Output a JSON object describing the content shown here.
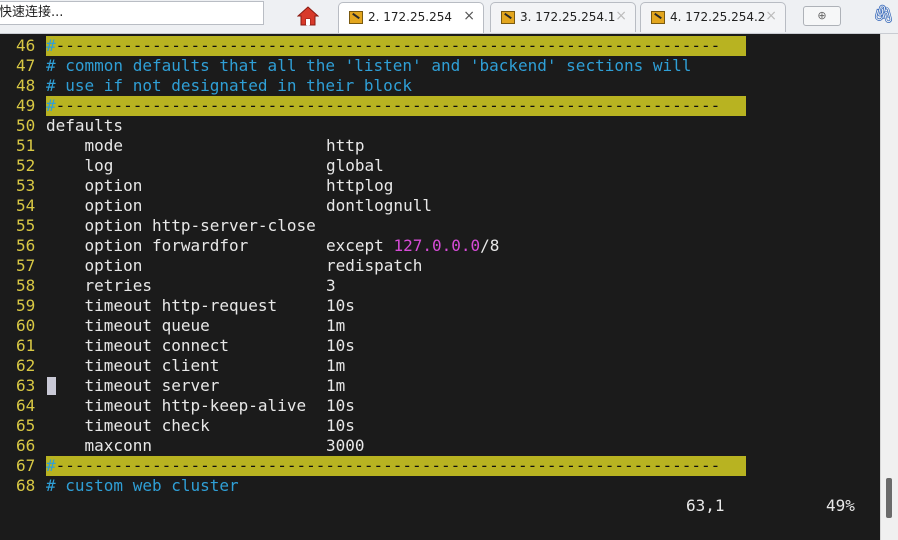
{
  "toolbar": {
    "quick_connect_placeholder": "快速连接..."
  },
  "tabs": [
    {
      "label": "2. 172.25.254",
      "active": true
    },
    {
      "label": "3. 172.25.254.1",
      "active": false
    },
    {
      "label": "4. 172.25.254.2",
      "active": false
    }
  ],
  "tab_close_glyph": "×",
  "icons": {
    "home": "home-icon",
    "session": "terminal-session-icon",
    "new_tab": "new-tab-icon",
    "attach": "paperclip-icon"
  },
  "colors": {
    "background": "#1b1b1b",
    "line_number": "#d8c844",
    "comment": "#2f9fd6",
    "highlight_bar": "#b8b321",
    "number_literal": "#d64bd6",
    "text": "#e8e8e8"
  },
  "editor": {
    "lines": [
      {
        "n": "46",
        "hash": "#",
        "rest": "---------------------------------------------------------------------"
      },
      {
        "n": "47",
        "comment": "# common defaults that all the 'listen' and 'backend' sections will"
      },
      {
        "n": "48",
        "comment": "# use if not designated in their block"
      },
      {
        "n": "49",
        "hash": "#",
        "rest": "---------------------------------------------------------------------"
      },
      {
        "n": "50",
        "key": "defaults",
        "val": ""
      },
      {
        "n": "51",
        "key": "    mode",
        "val": "http"
      },
      {
        "n": "52",
        "key": "    log",
        "val": "global"
      },
      {
        "n": "53",
        "key": "    option",
        "val": "httplog"
      },
      {
        "n": "54",
        "key": "    option",
        "val": "dontlognull"
      },
      {
        "n": "55",
        "key": "    option http-server-close",
        "val": ""
      },
      {
        "n": "56",
        "key": "    option forwardfor",
        "val": "except",
        "ip": "127.0.0.0",
        "suffix": "/8"
      },
      {
        "n": "57",
        "key": "    option",
        "val": "redispatch"
      },
      {
        "n": "58",
        "key": "    retries",
        "val": "3"
      },
      {
        "n": "59",
        "key": "    timeout http-request",
        "val": "10s"
      },
      {
        "n": "60",
        "key": "    timeout queue",
        "val": "1m"
      },
      {
        "n": "61",
        "key": "    timeout connect",
        "val": "10s"
      },
      {
        "n": "62",
        "key": "    timeout client",
        "val": "1m"
      },
      {
        "n": "63",
        "key": "    timeout server",
        "val": "1m"
      },
      {
        "n": "64",
        "key": "    timeout http-keep-alive",
        "val": "10s"
      },
      {
        "n": "65",
        "key": "    timeout check",
        "val": "10s"
      },
      {
        "n": "66",
        "key": "    maxconn",
        "val": "3000"
      },
      {
        "n": "67",
        "hash": "#",
        "rest": "---------------------------------------------------------------------"
      },
      {
        "n": "68",
        "comment": "# custom web cluster"
      }
    ],
    "cursor_position": "63,1",
    "scroll_percent": "49%"
  }
}
